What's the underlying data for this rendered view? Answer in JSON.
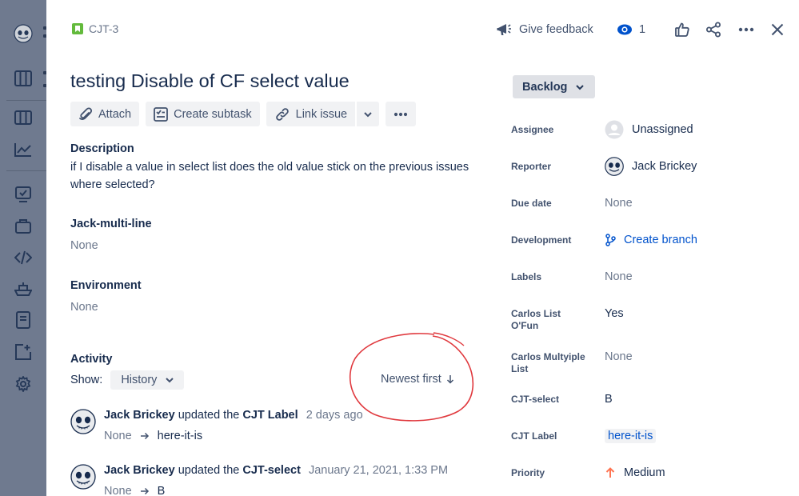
{
  "issue": {
    "key": "CJT-3",
    "title": "testing Disable of CF select value"
  },
  "top_actions": {
    "feedback_label": "Give feedback",
    "watch_count": "1"
  },
  "toolbar": {
    "attach": "Attach",
    "create_subtask": "Create subtask",
    "link_issue": "Link issue"
  },
  "description": {
    "label": "Description",
    "text": "if I disable a value in select list does the old value stick on the previous issues where selected?"
  },
  "custom_fields": [
    {
      "label": "Jack-multi-line",
      "value": "None"
    },
    {
      "label": "Environment",
      "value": "None"
    }
  ],
  "activity": {
    "label": "Activity",
    "show_label": "Show:",
    "filter": "History",
    "sort": "Newest first",
    "items": [
      {
        "user": "Jack Brickey",
        "verb": "updated the",
        "field": "CJT Label",
        "time": "2 days ago",
        "from": "None",
        "to": "here-it-is"
      },
      {
        "user": "Jack Brickey",
        "verb": "updated the",
        "field": "CJT-select",
        "time": "January 21, 2021, 1:33 PM",
        "from": "None",
        "to": "B"
      }
    ]
  },
  "status": "Backlog",
  "fields": {
    "assignee": {
      "label": "Assignee",
      "value": "Unassigned"
    },
    "reporter": {
      "label": "Reporter",
      "value": "Jack Brickey"
    },
    "due_date": {
      "label": "Due date",
      "value": "None"
    },
    "development": {
      "label": "Development",
      "value": "Create branch"
    },
    "labels": {
      "label": "Labels",
      "value": "None"
    },
    "carlos_list": {
      "label": "Carlos List O'Fun",
      "value": "Yes"
    },
    "carlos_multi": {
      "label": "Carlos Multyiple List",
      "value": "None"
    },
    "cjt_select": {
      "label": "CJT-select",
      "value": "B"
    },
    "cjt_label": {
      "label": "CJT Label",
      "value": "here-it-is"
    },
    "priority": {
      "label": "Priority",
      "value": "Medium"
    }
  },
  "colors": {
    "brand_blue": "#0052cc",
    "story_green": "#63ba3c",
    "annotation_red": "#e0393e",
    "priority_orange": "#ff7452"
  }
}
